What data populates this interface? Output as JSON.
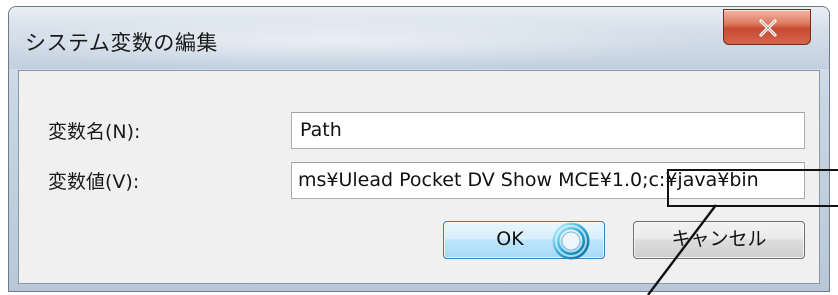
{
  "window": {
    "title": "システム変数の編集",
    "close_label": "X"
  },
  "form": {
    "name_label": "変数名(N):",
    "name_value": "Path",
    "value_label": "変数値(V):",
    "value_value": "ms¥Ulead Pocket DV Show MCE¥1.0;c:¥java¥bin"
  },
  "buttons": {
    "ok_label": "OK",
    "cancel_label": "キャンセル"
  },
  "icons": {
    "close": "close-icon",
    "busy": "busy-cursor-icon"
  }
}
